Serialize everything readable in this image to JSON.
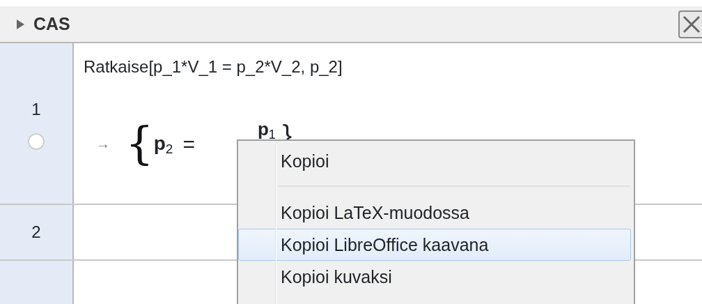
{
  "panel": {
    "title": "CAS",
    "collapsed": true
  },
  "rows": [
    {
      "number": "1",
      "input": "Ratkaise[p_1*V_1 = p_2*V_2, p_2]",
      "arrow": "→",
      "output": {
        "open": "{",
        "lhs": "p$_{2}$",
        "equals": "=",
        "numerator": "p$_{1}$",
        "close": "}"
      },
      "plotted": false
    },
    {
      "number": "2"
    }
  ],
  "context_menu": [
    {
      "kind": "item",
      "label": "Kopioi",
      "selected": false
    },
    {
      "kind": "separator"
    },
    {
      "kind": "item",
      "label": "Kopioi LaTeX-muodossa",
      "selected": false
    },
    {
      "kind": "item",
      "label": "Kopioi LibreOffice kaavana",
      "selected": true
    },
    {
      "kind": "item",
      "label": "Kopioi kuvaksi",
      "selected": false
    }
  ]
}
